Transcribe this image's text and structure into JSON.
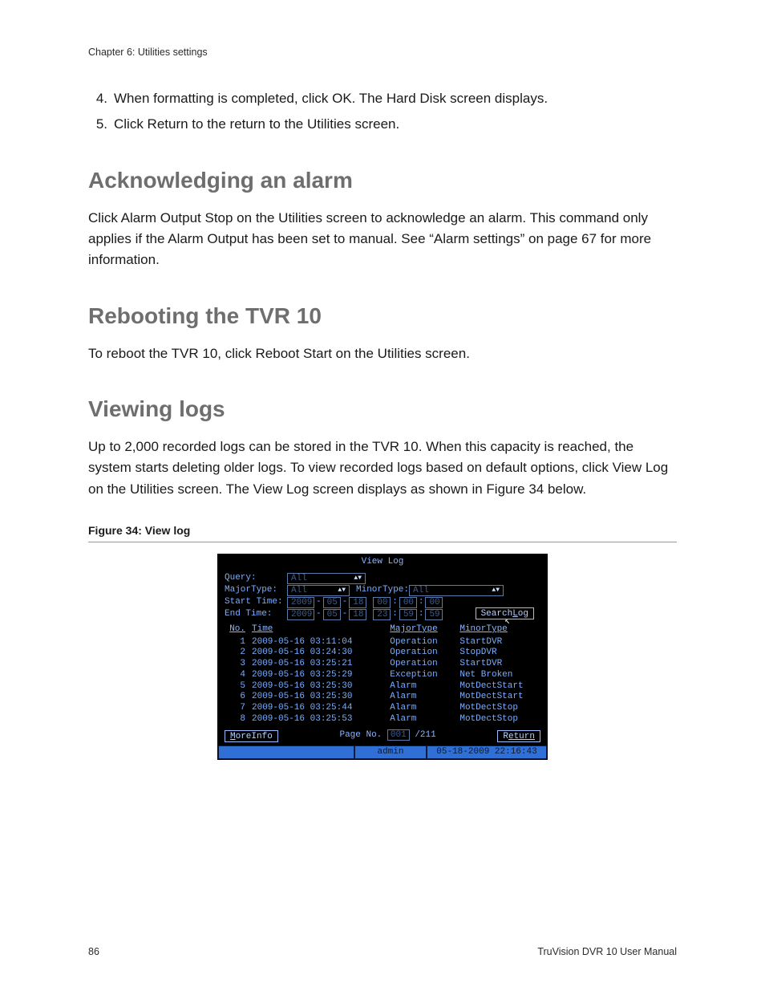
{
  "running_head": "Chapter 6: Utilities settings",
  "steps": [
    {
      "n": "4.",
      "t": "When formatting is completed, click OK. The Hard Disk screen displays."
    },
    {
      "n": "5.",
      "t": "Click Return to the return to the Utilities screen."
    }
  ],
  "sections": {
    "ack": {
      "heading": "Acknowledging an alarm",
      "body": "Click Alarm Output Stop on the Utilities screen to acknowledge an alarm. This command only applies if the Alarm Output has been set to manual. See “Alarm settings” on page 67 for more information."
    },
    "reboot": {
      "heading": "Rebooting the TVR 10",
      "body": "To reboot the TVR 10, click Reboot Start on the Utilities screen."
    },
    "logs": {
      "heading": "Viewing logs",
      "body": "Up to 2,000 recorded logs can be stored in the TVR 10. When this capacity is reached, the system starts deleting older logs. To view recorded logs based on default options, click View Log on the Utilities screen. The View Log screen displays as shown in Figure 34 below."
    }
  },
  "figure_caption": "Figure 34: View log",
  "dvr": {
    "title": "View Log",
    "labels": {
      "query": "Query:",
      "major": "MajorType:",
      "minor": "MinorType:",
      "start": "Start Time:",
      "end": "End Time:"
    },
    "query_value": "All",
    "major_value": "All",
    "minor_value": "All",
    "start_date": {
      "y": "2009",
      "m": "05",
      "d": "18"
    },
    "start_time": {
      "h": "00",
      "mi": "00",
      "s": "00"
    },
    "end_date": {
      "y": "2009",
      "m": "05",
      "d": "18"
    },
    "end_time": {
      "h": "23",
      "mi": "59",
      "s": "59"
    },
    "search_btn_prefix": "Search",
    "search_btn_key": "L",
    "search_btn_suffix": "og",
    "columns": {
      "no": "No.",
      "time": "Time",
      "major": "MajorType",
      "minor": "MinorType"
    },
    "rows": [
      {
        "no": "1",
        "time": "2009-05-16 03:11:04",
        "major": "Operation",
        "minor": "StartDVR"
      },
      {
        "no": "2",
        "time": "2009-05-16 03:24:30",
        "major": "Operation",
        "minor": "StopDVR"
      },
      {
        "no": "3",
        "time": "2009-05-16 03:25:21",
        "major": "Operation",
        "minor": "StartDVR"
      },
      {
        "no": "4",
        "time": "2009-05-16 03:25:29",
        "major": "Exception",
        "minor": "Net Broken"
      },
      {
        "no": "5",
        "time": "2009-05-16 03:25:30",
        "major": "Alarm",
        "minor": "MotDectStart"
      },
      {
        "no": "6",
        "time": "2009-05-16 03:25:30",
        "major": "Alarm",
        "minor": "MotDectStart"
      },
      {
        "no": "7",
        "time": "2009-05-16 03:25:44",
        "major": "Alarm",
        "minor": "MotDectStop"
      },
      {
        "no": "8",
        "time": "2009-05-16 03:25:53",
        "major": "Alarm",
        "minor": "MotDectStop"
      }
    ],
    "moreinfo_key": "M",
    "moreinfo_rest": "oreInfo",
    "pager_label": "Page No.",
    "pager_current": "001",
    "pager_total": "/211",
    "return_prefix": "R",
    "return_rest": "eturn",
    "status_user": "admin",
    "status_time": "05-18-2009 22:16:43"
  },
  "footer": {
    "page": "86",
    "manual": "TruVision DVR 10 User Manual"
  }
}
